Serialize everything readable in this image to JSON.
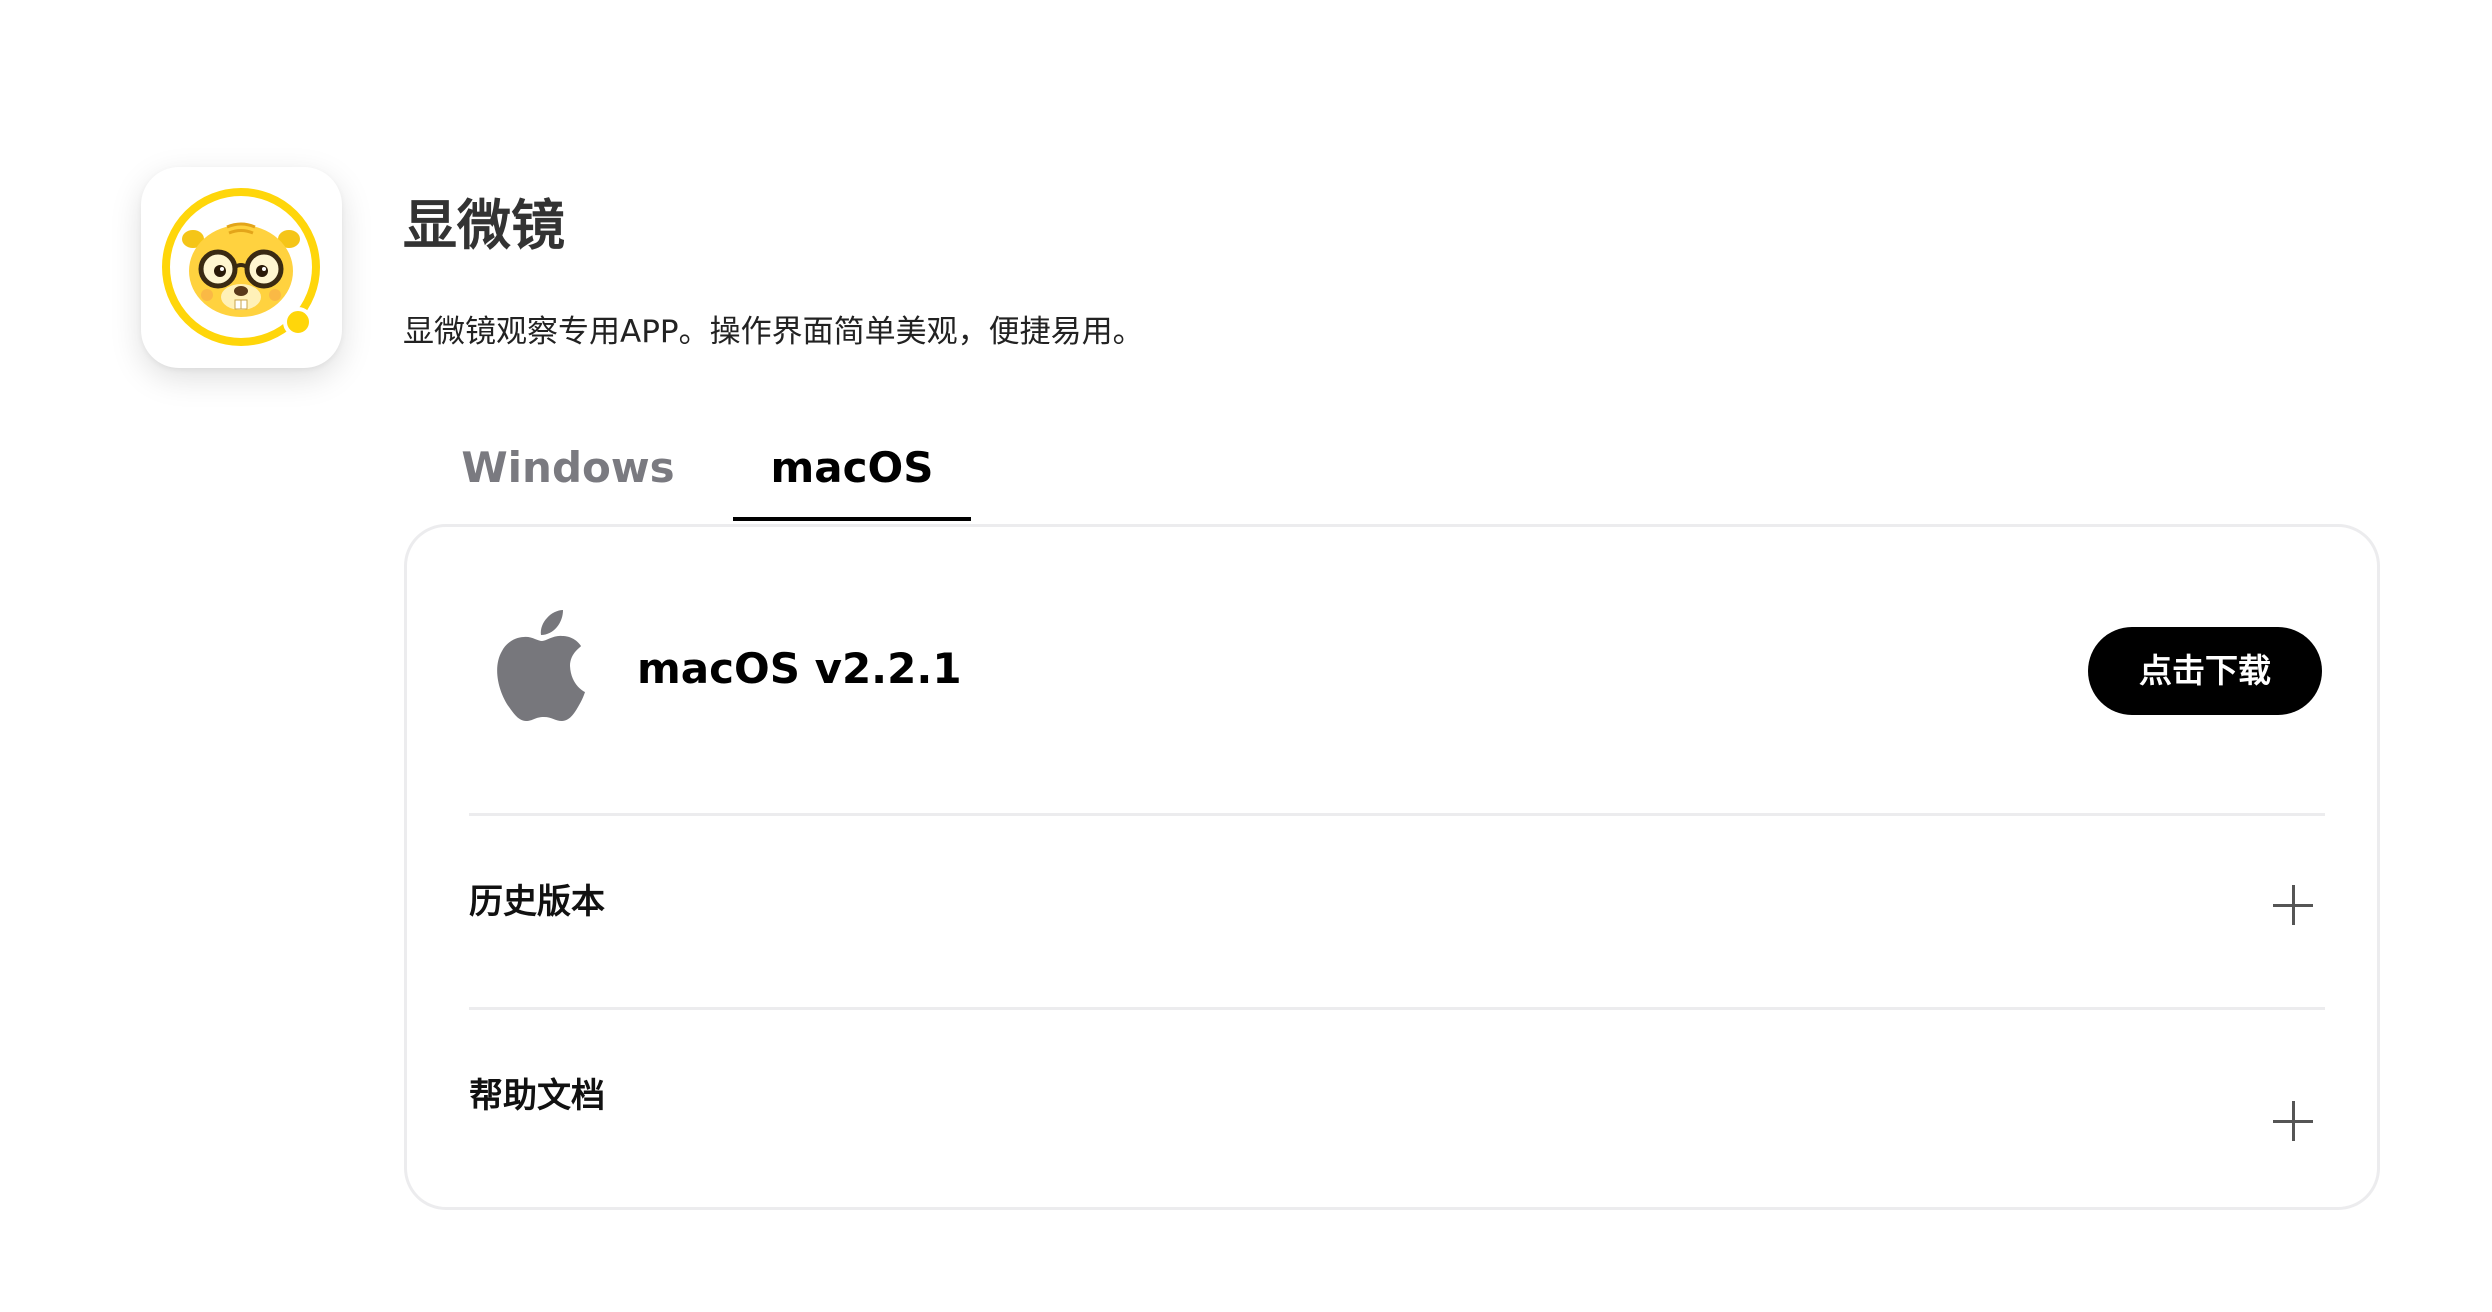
{
  "app": {
    "name": "显微镜",
    "description": "显微镜观察专用APP。操作界面简单美观，便捷易用。",
    "icon": "beaver-mascot-icon",
    "accent_color": "#FFD60A"
  },
  "tabs": [
    {
      "label": "Windows",
      "selected": false
    },
    {
      "label": "macOS",
      "selected": true
    }
  ],
  "download": {
    "platform_icon": "apple-logo-icon",
    "version_label": "macOS v2.2.1",
    "button_label": "点击下载"
  },
  "sections": [
    {
      "label": "历史版本",
      "icon": "plus-icon",
      "expanded": false
    },
    {
      "label": "帮助文档",
      "icon": "plus-icon",
      "expanded": false
    }
  ]
}
